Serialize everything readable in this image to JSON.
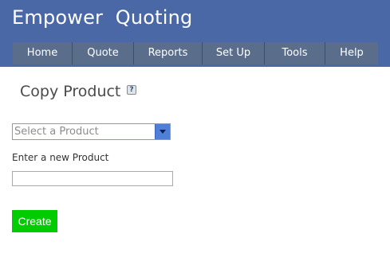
{
  "header": {
    "title": "Empower  Quoting",
    "nav": [
      {
        "label": "Home"
      },
      {
        "label": "Quote"
      },
      {
        "label": "Reports"
      },
      {
        "label": "Set Up"
      },
      {
        "label": "Tools"
      },
      {
        "label": "Help"
      }
    ]
  },
  "main": {
    "page_title": "Copy Product",
    "help_icon": {
      "icon": "help-icon",
      "glyph": "?"
    },
    "product_select": {
      "selected_text": "Select a Product"
    },
    "new_product_label": "Enter a new Product",
    "new_product_input": {
      "value": "",
      "placeholder": ""
    },
    "create_button_label": "Create"
  },
  "colors": {
    "header_bg": "#4a68a5",
    "nav_bg": "#5a6e8c",
    "create_button_bg": "#00cc00"
  }
}
